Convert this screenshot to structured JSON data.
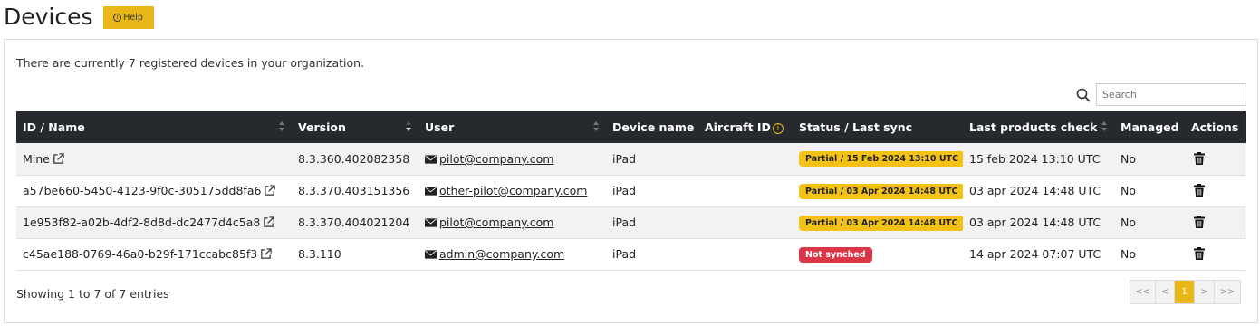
{
  "header": {
    "title": "Devices",
    "help_label": "Help"
  },
  "summary": "There are currently 7 registered devices in your organization.",
  "search": {
    "placeholder": "Search",
    "value": ""
  },
  "table": {
    "columns": [
      "ID / Name",
      "Version",
      "User",
      "Device name",
      "Aircraft ID",
      "Status / Last sync",
      "Last products check",
      "Managed",
      "Actions"
    ],
    "rows": [
      {
        "id_name": "Mine",
        "version": "8.3.360.402082358",
        "user": "pilot@company.com",
        "device_name": "iPad",
        "aircraft_id": "",
        "status": "Partial / 15 Feb 2024 13:10 UTC",
        "status_type": "partial",
        "last_check": "15 feb 2024 13:10 UTC",
        "managed": "No"
      },
      {
        "id_name": "a57be660-5450-4123-9f0c-305175dd8fa6",
        "version": "8.3.370.403151356",
        "user": "other-pilot@company.com",
        "device_name": "iPad",
        "aircraft_id": "",
        "status": "Partial / 03 Apr 2024 14:48 UTC",
        "status_type": "partial",
        "last_check": "03 apr 2024 14:48 UTC",
        "managed": "No"
      },
      {
        "id_name": "1e953f82-a02b-4df2-8d8d-dc2477d4c5a8",
        "version": "8.3.370.404021204",
        "user": "pilot@company.com",
        "device_name": "iPad",
        "aircraft_id": "",
        "status": "Partial / 03 Apr 2024 14:48 UTC",
        "status_type": "partial",
        "last_check": "03 apr 2024 14:48 UTC",
        "managed": "No"
      },
      {
        "id_name": "c45ae188-0769-46a0-b29f-171ccabc85f3",
        "version": "8.3.110",
        "user": "admin@company.com",
        "device_name": "iPad",
        "aircraft_id": "",
        "status": "Not synched",
        "status_type": "error",
        "last_check": "14 apr 2024 07:07 UTC",
        "managed": "No"
      }
    ]
  },
  "footer": {
    "info": "Showing 1 to 7 of 7 entries"
  },
  "pagination": {
    "first": "<<",
    "prev": "<",
    "current": "1",
    "next": ">",
    "last": ">>"
  },
  "colors": {
    "accent": "#e9b818",
    "header_bg": "#262a2e",
    "error": "#dc3545"
  }
}
